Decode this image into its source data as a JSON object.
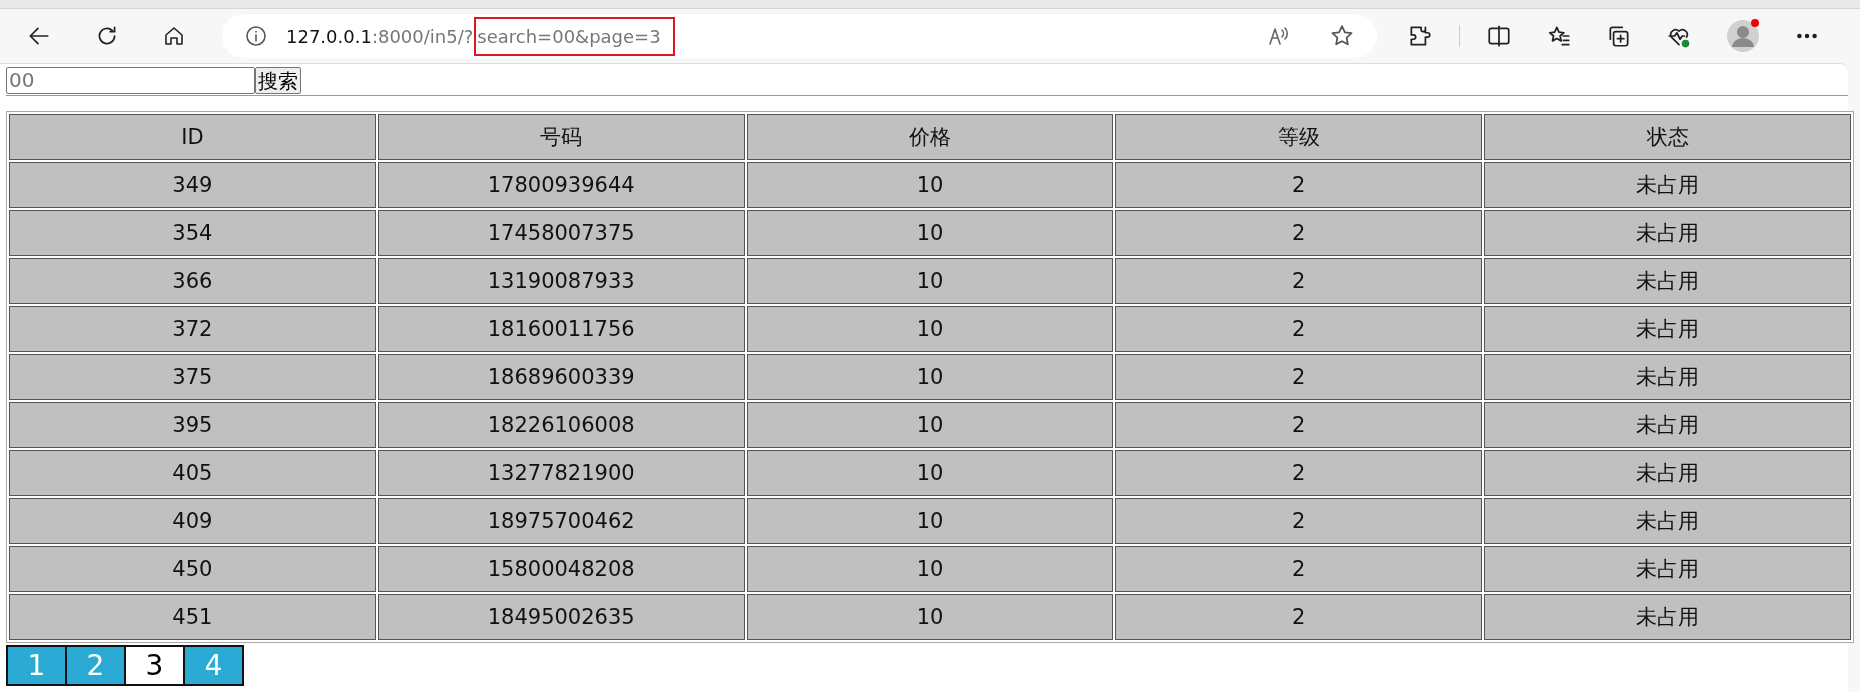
{
  "browser": {
    "url_host": "127.0.0.1",
    "url_path": ":8000/in5/?",
    "url_query": "search=00&page=3"
  },
  "search": {
    "value": "00",
    "button": "搜索"
  },
  "table": {
    "columns": [
      "ID",
      "号码",
      "价格",
      "等级",
      "状态"
    ],
    "rows": [
      [
        "349",
        "17800939644",
        "10",
        "2",
        "未占用"
      ],
      [
        "354",
        "17458007375",
        "10",
        "2",
        "未占用"
      ],
      [
        "366",
        "13190087933",
        "10",
        "2",
        "未占用"
      ],
      [
        "372",
        "18160011756",
        "10",
        "2",
        "未占用"
      ],
      [
        "375",
        "18689600339",
        "10",
        "2",
        "未占用"
      ],
      [
        "395",
        "18226106008",
        "10",
        "2",
        "未占用"
      ],
      [
        "405",
        "13277821900",
        "10",
        "2",
        "未占用"
      ],
      [
        "409",
        "18975700462",
        "10",
        "2",
        "未占用"
      ],
      [
        "450",
        "15800048208",
        "10",
        "2",
        "未占用"
      ],
      [
        "451",
        "18495002635",
        "10",
        "2",
        "未占用"
      ]
    ]
  },
  "pagination": [
    {
      "label": "1",
      "selected": false
    },
    {
      "label": "2",
      "selected": false
    },
    {
      "label": "3",
      "selected": true
    },
    {
      "label": "4",
      "selected": false
    }
  ]
}
